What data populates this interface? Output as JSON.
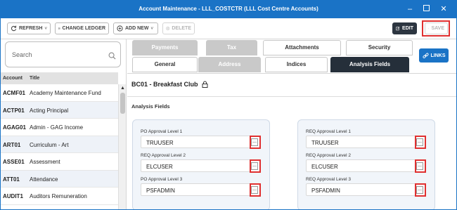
{
  "window": {
    "title": "Account Maintenance - LLL_COSTCTR (LLL Cost Centre Accounts)"
  },
  "toolbar": {
    "refresh_label": "REFRESH",
    "change_ledger_label": "CHANGE LEDGER",
    "add_new_label": "ADD NEW",
    "delete_label": "DELETE",
    "edit_label": "EDIT",
    "save_label": "SAVE"
  },
  "search": {
    "placeholder": "Search"
  },
  "list": {
    "col_account": "Account",
    "col_title": "Title",
    "rows": [
      {
        "code": "ACMF01",
        "title": "Academy Maintenance Fund"
      },
      {
        "code": "ACTP01",
        "title": "Acting Principal"
      },
      {
        "code": "AGAG01",
        "title": "Admin - GAG Income"
      },
      {
        "code": "ART01",
        "title": "Curriculum - Art"
      },
      {
        "code": "ASSE01",
        "title": "Assessment"
      },
      {
        "code": "ATT01",
        "title": "Attendance"
      },
      {
        "code": "AUDIT1",
        "title": "Auditors Remuneration"
      }
    ]
  },
  "tabs": {
    "payments": "Payments",
    "tax": "Tax",
    "attachments": "Attachments",
    "security": "Security",
    "general": "General",
    "address": "Address",
    "indices": "Indices",
    "analysis_fields": "Analysis Fields"
  },
  "links_label": "LINKS",
  "record": {
    "title": "BC01 - Breakfast Club"
  },
  "analysis": {
    "section_title": "Analysis Fields",
    "left": [
      {
        "label": "PO Approval Level 1",
        "value": "TRUUSER"
      },
      {
        "label": "REQ Approval Level 2",
        "value": "ELCUSER"
      },
      {
        "label": "PO Approval Level 3",
        "value": "PSFADMIN"
      }
    ],
    "right": [
      {
        "label": "REQ Approval Level 1",
        "value": "TRUUSER"
      },
      {
        "label": "REQ Approval Level 2",
        "value": "ELCUSER"
      },
      {
        "label": "REQ Approval Level 3",
        "value": "PSFADMIN"
      }
    ],
    "ellipsis": "..."
  },
  "colors": {
    "brand": "#1a73c6",
    "active_tab": "#252f3a",
    "highlight": "#e03030"
  }
}
